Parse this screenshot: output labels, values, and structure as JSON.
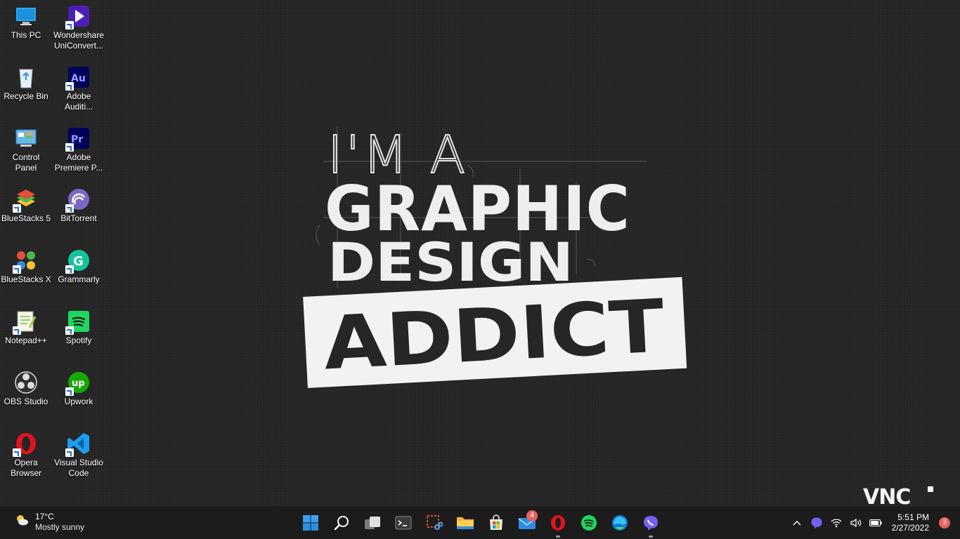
{
  "wallpaper": {
    "line1": "I'M A",
    "line2": "GRAPHIC",
    "line3": "DESIGN",
    "line4": "ADDICT"
  },
  "desktop_icons": [
    {
      "label": "This PC",
      "icon": "this-pc-icon"
    },
    {
      "label": "Wondershare\nUniConvert...",
      "icon": "wondershare-icon"
    },
    {
      "label": "Recycle Bin",
      "icon": "recycle-bin-icon"
    },
    {
      "label": "Adobe\nAuditi...",
      "icon": "adobe-audition-icon"
    },
    {
      "label": "Control\nPanel",
      "icon": "control-panel-icon"
    },
    {
      "label": "Adobe\nPremiere P...",
      "icon": "adobe-premiere-icon"
    },
    {
      "label": "BlueStacks 5",
      "icon": "bluestacks5-icon"
    },
    {
      "label": "BitTorrent",
      "icon": "bittorrent-icon"
    },
    {
      "label": "BlueStacks X",
      "icon": "bluestacks-x-icon"
    },
    {
      "label": "Grammarly",
      "icon": "grammarly-icon"
    },
    {
      "label": "Notepad++",
      "icon": "notepadpp-icon"
    },
    {
      "label": "Spotify",
      "icon": "spotify-icon"
    },
    {
      "label": "OBS Studio",
      "icon": "obs-icon"
    },
    {
      "label": "Upwork",
      "icon": "upwork-icon"
    },
    {
      "label": "Opera\nBrowser",
      "icon": "opera-icon"
    },
    {
      "label": "Visual Studio\nCode",
      "icon": "vscode-icon"
    }
  ],
  "taskbar": {
    "weather": {
      "temp": "17°C",
      "condition": "Mostly sunny"
    },
    "apps": [
      {
        "name": "start",
        "icon": "windows-start-icon"
      },
      {
        "name": "search",
        "icon": "search-icon"
      },
      {
        "name": "task-view",
        "icon": "task-view-icon"
      },
      {
        "name": "terminal",
        "icon": "terminal-icon"
      },
      {
        "name": "snipping-tool",
        "icon": "snipping-tool-icon"
      },
      {
        "name": "file-explorer",
        "icon": "folder-icon"
      },
      {
        "name": "microsoft-store",
        "icon": "store-icon"
      },
      {
        "name": "mail",
        "icon": "mail-icon",
        "badge": "4"
      },
      {
        "name": "opera",
        "icon": "opera-icon",
        "running": true
      },
      {
        "name": "spotify",
        "icon": "spotify-icon"
      },
      {
        "name": "edge",
        "icon": "edge-icon"
      },
      {
        "name": "viber",
        "icon": "viber-icon",
        "running": true
      }
    ],
    "tray": {
      "time": "5:51 PM",
      "date": "2/27/2022",
      "notifications": "3"
    }
  },
  "watermark": "VNC"
}
